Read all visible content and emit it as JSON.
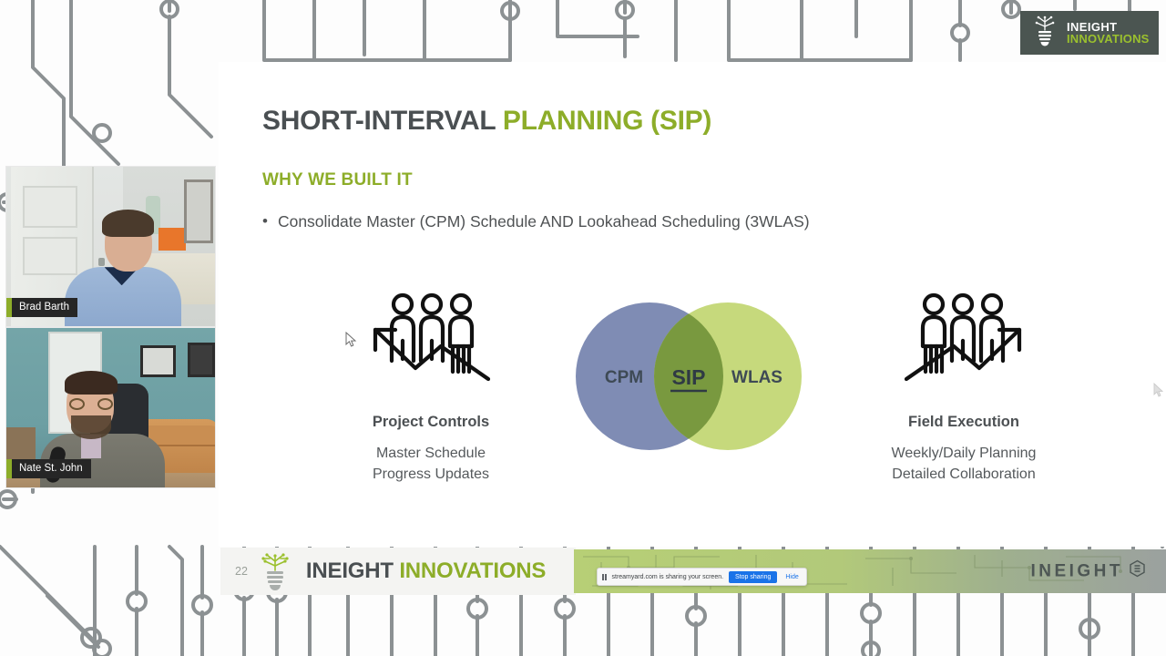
{
  "slide": {
    "title_dark": "SHORT-INTERVAL ",
    "title_green": "PLANNING (SIP)",
    "subtitle": "WHY WE BUILT IT",
    "bullet_marker": "•",
    "bullet": "Consolidate Master (CPM) Schedule AND Lookahead Scheduling (3WLAS)",
    "columns": [
      {
        "icon": "three-people-down-arrow-icon",
        "heading": "Project Controls",
        "sub_line1": "Master Schedule",
        "sub_line2": "Progress Updates"
      },
      {
        "icon": "three-people-up-arrow-icon",
        "heading": "Field Execution",
        "sub_line1": "Weekly/Daily Planning",
        "sub_line2": "Detailed Collaboration"
      }
    ],
    "venn": {
      "left_label": "CPM",
      "center_label": "SIP",
      "right_label": "WLAS",
      "left_color": "#7f8cb4",
      "right_color": "#c6d97c",
      "overlap_color": "#79993f",
      "label_color": "#3e4a55"
    }
  },
  "footer": {
    "page_number": "22",
    "bulb_icon": "circuit-tree-lightbulb-icon",
    "brand_dark": "INEIGHT ",
    "brand_green": "INNOVATIONS",
    "right_brand": "INEIGHT",
    "right_brand_icon": "ineight-hex-icon"
  },
  "badge": {
    "icon": "circuit-tree-lightbulb-icon",
    "line1": "INEIGHT",
    "line2": "INNOVATIONS",
    "bg_color": "#4b5551",
    "accent_color": "#9bc02e"
  },
  "participants": [
    {
      "name": "Brad Barth",
      "accent_color": "#8dad29"
    },
    {
      "name": "Nate St. John",
      "accent_color": "#8dad29"
    }
  ],
  "share_bar": {
    "pause_icon": "pause-icon",
    "message": "streamyard.com is sharing your screen.",
    "stop_label": "Stop sharing",
    "hide_label": "Hide",
    "accent_color": "#1a73e8"
  },
  "cursor": {
    "main_icon": "mouse-pointer-icon",
    "edge_icon": "mouse-pointer-icon"
  },
  "theme": {
    "green": "#8dad29",
    "dark_gray": "#4a4f52",
    "body_gray": "#55595c",
    "circuit_gray": "#8c9193"
  }
}
